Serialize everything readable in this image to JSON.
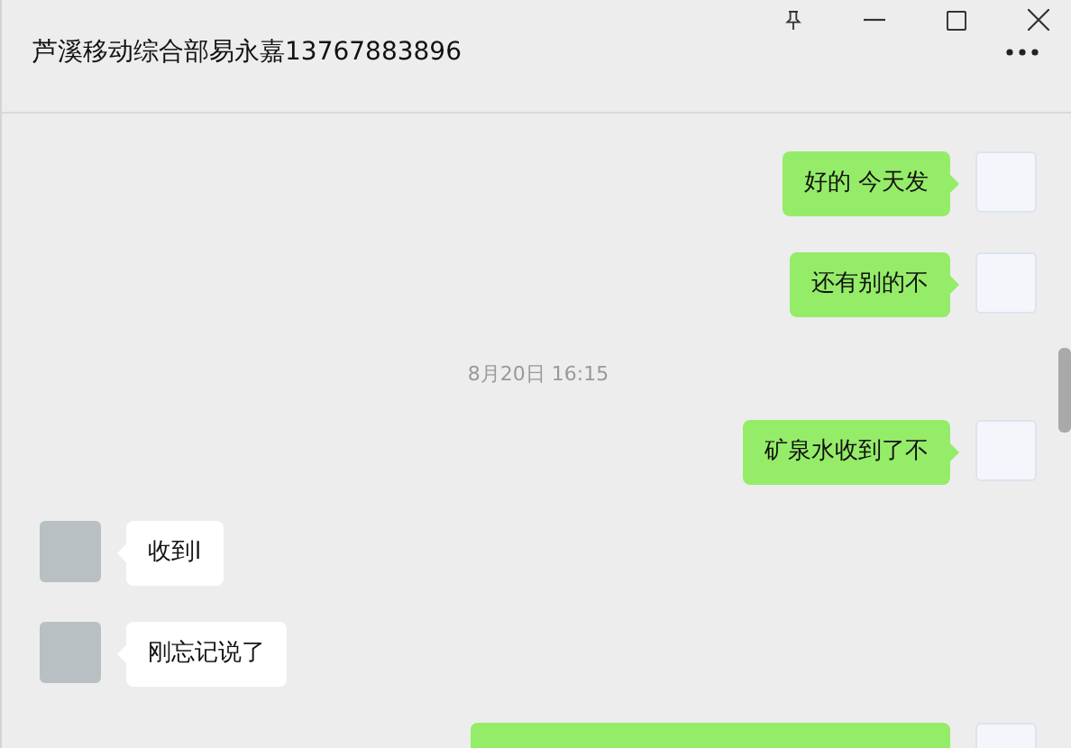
{
  "window": {
    "title": "芦溪移动综合部易永嘉13767883896"
  },
  "messages": [
    {
      "kind": "out",
      "text": "好的 今天发"
    },
    {
      "kind": "out",
      "text": "还有别的不"
    },
    {
      "kind": "time",
      "text": "8月20日 16:15"
    },
    {
      "kind": "out",
      "text": "矿泉水收到了不"
    },
    {
      "kind": "in",
      "text": "收到l"
    },
    {
      "kind": "in",
      "text": "刚忘记说了"
    },
    {
      "kind": "out_cut"
    }
  ]
}
